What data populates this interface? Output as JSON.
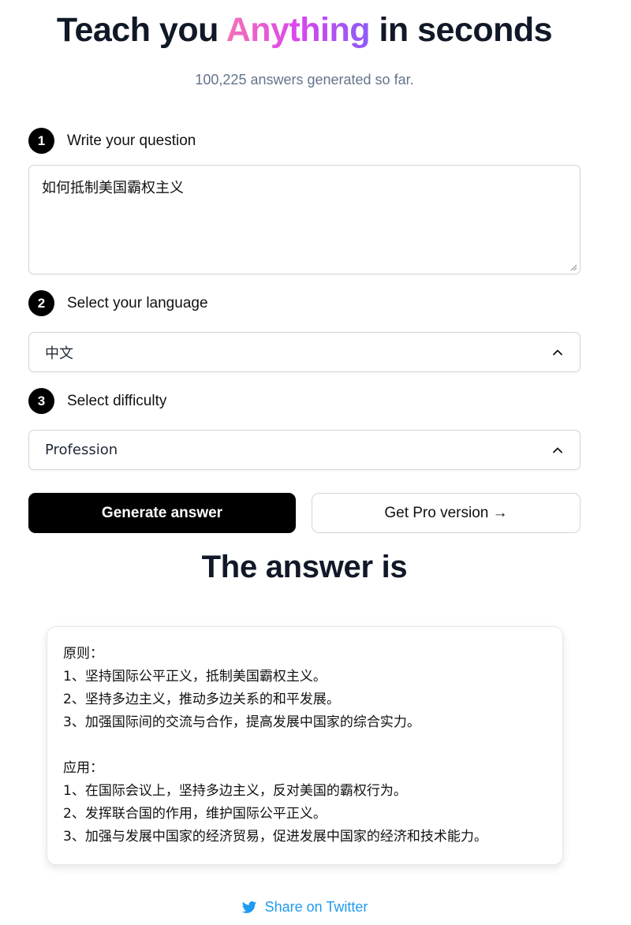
{
  "header": {
    "title_prefix": "Teach you",
    "title_highlight": "Anything",
    "title_suffix": "in seconds",
    "counter": "100,225 answers generated so far."
  },
  "steps": [
    {
      "number": "1",
      "label": "Write your question"
    },
    {
      "number": "2",
      "label": "Select your language"
    },
    {
      "number": "3",
      "label": "Select difficulty"
    }
  ],
  "question": {
    "value": "如何抵制美国霸权主义"
  },
  "language_select": {
    "value": "中文",
    "icon": "chevron-up-icon"
  },
  "difficulty_select": {
    "value": "Profession",
    "icon": "chevron-up-icon"
  },
  "buttons": {
    "generate": "Generate answer",
    "pro": "Get Pro version →"
  },
  "answer": {
    "title": "The answer is",
    "lines": [
      "原则：",
      "1、坚持国际公平正义，抵制美国霸权主义。",
      "2、坚持多边主义，推动多边关系的和平发展。",
      "3、加强国际间的交流与合作，提高发展中国家的综合实力。",
      "",
      "应用：",
      "1、在国际会议上，坚持多边主义，反对美国的霸权行为。",
      "2、发挥联合国的作用，维护国际公平正义。",
      "3、加强与发展中国家的经济贸易，促进发展中国家的经济和技术能力。"
    ]
  },
  "share": {
    "label": "Share on Twitter",
    "icon": "twitter-icon",
    "color": "#1d9bf0"
  },
  "colors": {
    "accent_gradient": [
      "#f472b6",
      "#d946ef",
      "#8b5cf6"
    ],
    "primary_button": "#000000"
  }
}
